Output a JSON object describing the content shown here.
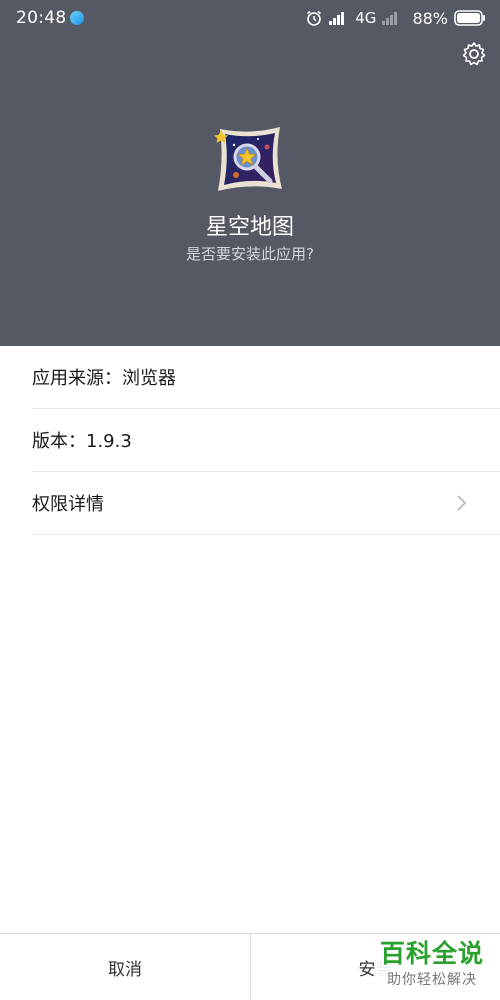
{
  "status_bar": {
    "time": "20:48",
    "network": "4G",
    "battery": "88%",
    "icons": [
      "alarm-icon",
      "signal-icon",
      "signal-weak-icon",
      "battery-icon"
    ]
  },
  "header": {
    "background": "#555963",
    "app_name": "星空地图",
    "question": "是否要安装此应用?"
  },
  "info": {
    "source": "应用来源：浏览器",
    "version": "版本：1.9.3",
    "permissions": "权限详情"
  },
  "actions": {
    "cancel": "取消",
    "install": "安装"
  },
  "watermark": {
    "title": "百科全说",
    "subtitle": "助你轻松解决",
    "color": "#2aa12e"
  }
}
